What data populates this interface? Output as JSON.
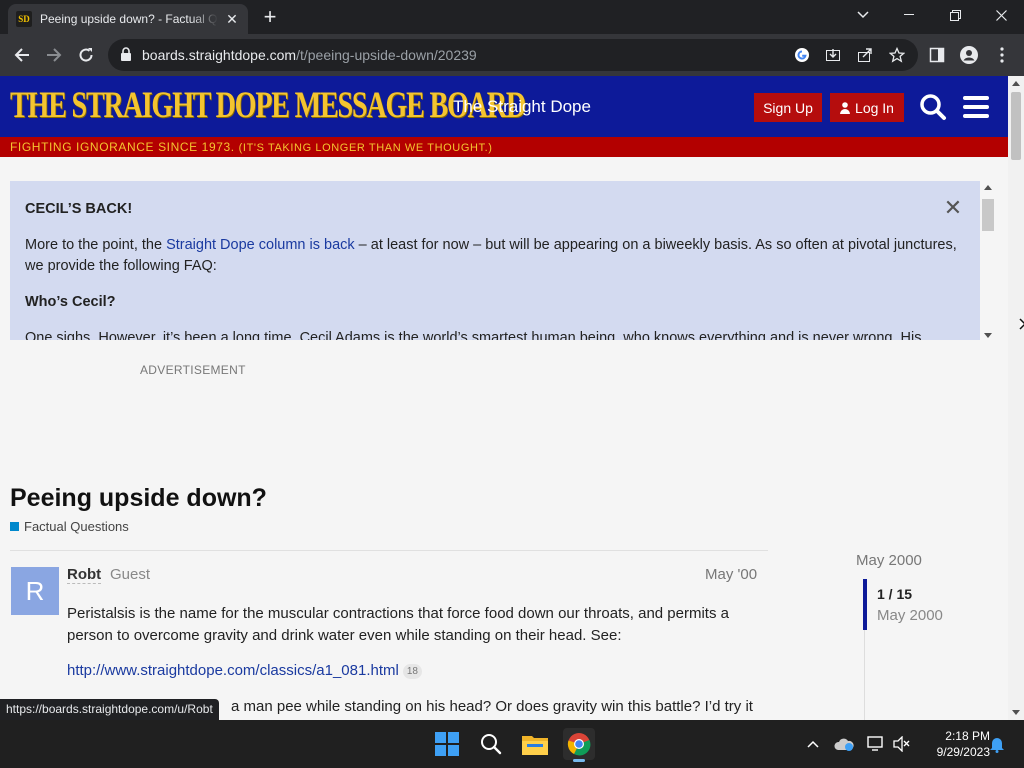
{
  "browser": {
    "tab_title": "Peeing upside down? - Factual Questions",
    "favicon_text": "SD",
    "url_host": "boards.straightdope.com",
    "url_path": "/t/peeing-upside-down/20239",
    "status_url": "https://boards.straightdope.com/u/Robt"
  },
  "header": {
    "logo": "THE STRAIGHT DOPE MESSAGE BOARD",
    "site_name": "The Straight Dope",
    "signup_label": "Sign Up",
    "login_label": "Log In",
    "tagline_main": "FIGHTING IGNORANCE SINCE 1973.",
    "tagline_sub": "(IT'S TAKING LONGER THAN WE THOUGHT.)"
  },
  "banner": {
    "heading": "CECIL’S BACK!",
    "para1_pre": "More to the point, the ",
    "para1_link": "Straight Dope column is back",
    "para1_post": " – at least for now – but will be appearing on a biweekly basis. As so often at pivotal junctures, we provide the following FAQ:",
    "subheading": "Who’s Cecil?",
    "para2": "One sighs. However, it’s been a long time. Cecil Adams is the world’s smartest human being, who knows everything and is never wrong. His"
  },
  "ad_label": "ADVERTISEMENT",
  "topic": {
    "title": "Peeing upside down?",
    "category": "Factual Questions"
  },
  "post": {
    "avatar_letter": "R",
    "username": "Robt",
    "role": "Guest",
    "date": "May '00",
    "body": "Peristalsis is the name for the muscular contractions that force food down our throats, and permits a person to overcome gravity and drink water even while standing on their head. See:",
    "link": "http://www.straightdope.com/classics/a1_081.html",
    "link_clicks": "18",
    "body2": "a man pee while standing on his head? Or does gravity win this battle? I’d try it"
  },
  "timeline": {
    "top_date": "May 2000",
    "position": "1 / 15",
    "position_date": "May 2000"
  },
  "taskbar": {
    "time": "2:18 PM",
    "date": "9/29/2023"
  },
  "colors": {
    "header_blue": "#0d1a99",
    "logo_gold": "#f4c430",
    "tagline_red": "#b30000",
    "button_red": "#b50d0d",
    "banner_bg": "#d3daf0",
    "link_blue": "#1a3aa0",
    "category_blue": "#0088cc"
  }
}
